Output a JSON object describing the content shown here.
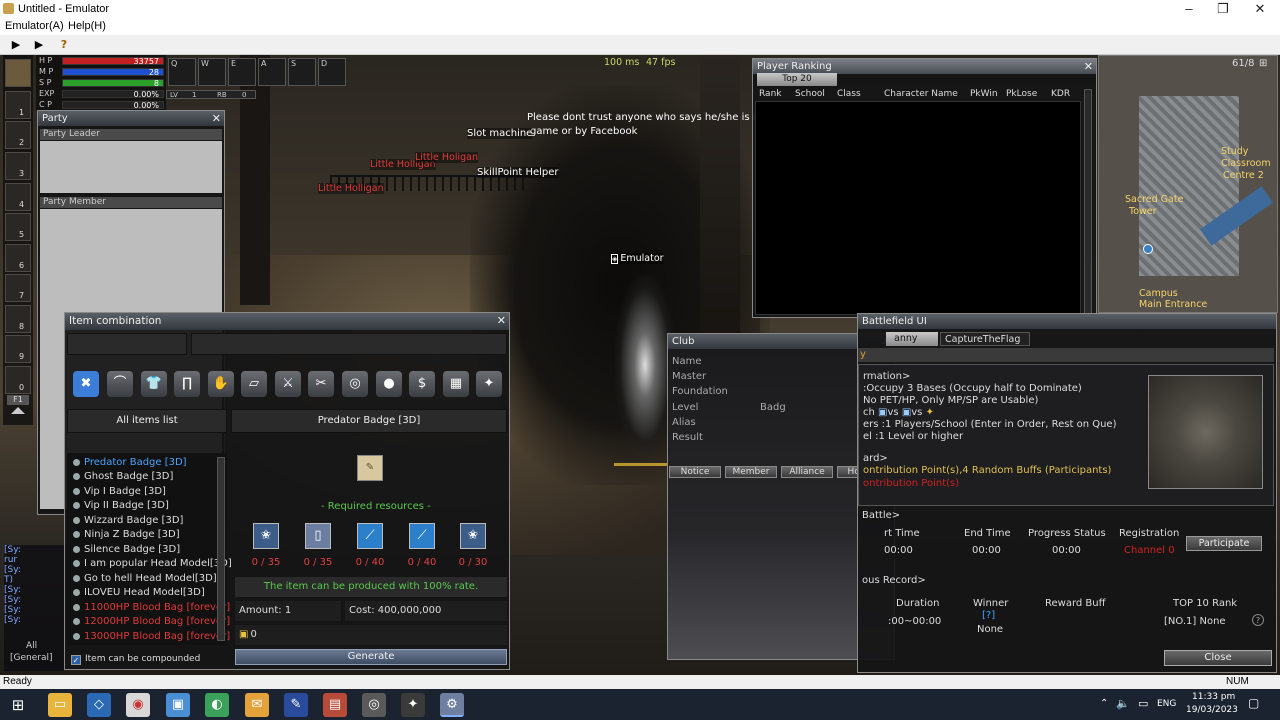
{
  "window": {
    "title": "Untitled - Emulator",
    "min": "‒",
    "max": "❐",
    "close": "✕"
  },
  "menu": {
    "emulator": "Emulator(A)",
    "help": "Help(H)"
  },
  "toolbar": {
    "play1": "▶",
    "play2": "▶",
    "help": "?"
  },
  "hud": {
    "latency": "100 ms",
    "fps": "47 fps",
    "hp_label": "H P",
    "hp_value": "33757",
    "hp_fill": 1.0,
    "mp_label": "M P",
    "mp_value": "28",
    "mp_fill": 1.0,
    "sp_label": "S P",
    "sp_value": "8",
    "sp_fill": 1.0,
    "exp_label": "EXP",
    "exp_value": "0.00%",
    "c_label": "C P",
    "c_value": "0.00%",
    "lv_label": "LV",
    "lv_value": "1",
    "rb_label": "RB",
    "rb_value": "0",
    "quick_keys": [
      "Q",
      "W",
      "E",
      "A",
      "S",
      "D"
    ],
    "hotbar_numbers": [
      "1",
      "2",
      "3",
      "4",
      "5",
      "6",
      "7",
      "8",
      "9",
      "0"
    ],
    "f1": "F1"
  },
  "world": {
    "notice": "Please dont trust anyone who says he/she is GM",
    "notice2": "game or by Facebook",
    "npc_slot": "Slot machine",
    "npc_skill": "SkillPoint Helper",
    "player1": "Little Holligan",
    "player2": "Little Holligan",
    "player3": "Little Holigan",
    "self": "Emulator"
  },
  "chat": {
    "lines": [
      "[Sy:",
      "rur",
      "[Sy:",
      "T)",
      "[Sy:",
      "[Sy:",
      "[Sy:",
      "[Sy:"
    ],
    "all": "All",
    "general": "[General]"
  },
  "party": {
    "title": "Party",
    "leader": "Party Leader",
    "member": "Party Member",
    "close": "✕"
  },
  "itemcomb": {
    "title": "Item combination",
    "close": "✕",
    "all_items": "All items list",
    "selected": "Predator Badge [3D]",
    "required": "- Required resources -",
    "items": [
      {
        "name": "Predator Badge [3D]",
        "color": "#4aa3ff"
      },
      {
        "name": "Ghost  Badge [3D]",
        "color": "#e8e8e8"
      },
      {
        "name": "Vip I Badge [3D]",
        "color": "#e8e8e8"
      },
      {
        "name": "Vip II Badge [3D]",
        "color": "#e8e8e8"
      },
      {
        "name": "Wizzard Badge [3D]",
        "color": "#e8e8e8"
      },
      {
        "name": "Ninja Z Badge [3D]",
        "color": "#e8e8e8"
      },
      {
        "name": "Silence Badge [3D]",
        "color": "#e8e8e8"
      },
      {
        "name": "I am popular Head Model[3D]",
        "color": "#e8e8e8"
      },
      {
        "name": "Go to hell Head Model[3D]",
        "color": "#e8e8e8"
      },
      {
        "name": "ILOVEU Head Model[3D]",
        "color": "#e8e8e8"
      },
      {
        "name": "11000HP Blood Bag [forever]",
        "color": "#e03a3a"
      },
      {
        "name": "12000HP Blood Bag [forever]",
        "color": "#e03a3a"
      },
      {
        "name": "13000HP Blood Bag [forever]",
        "color": "#e03a3a"
      }
    ],
    "resources": [
      "0 / 35",
      "0 / 35",
      "0 / 40",
      "0 / 40",
      "0 / 30"
    ],
    "rate": "The item can be produced with 100% rate.",
    "amount": "Amount: 1",
    "cost": "Cost: 400,000,000",
    "money": "0",
    "compound": "Item can be compounded",
    "generate": "Generate"
  },
  "club": {
    "title": "Club",
    "close": "✕",
    "name": "Name",
    "master": "Master",
    "foundation": "Foundation",
    "level": "Level",
    "level_value": "Badg",
    "alias": "Alias",
    "result": "Result",
    "tabs": [
      "Notice",
      "Member",
      "Alliance",
      "Hostile"
    ]
  },
  "ranking": {
    "title": "Player Ranking",
    "tab": "Top 20",
    "close": "✕",
    "columns": [
      "Rank",
      "School",
      "Class",
      "Character Name",
      "PkWin",
      "PkLose",
      "KDR"
    ]
  },
  "minimap": {
    "counter": "61/8",
    "study": "Study",
    "classroom": "Classroom",
    "centre": "Centre 2",
    "sacred1": "Sacred Gate",
    "sacred2": "Tower",
    "campus": "Campus",
    "main_entrance": "Main Entrance"
  },
  "battle": {
    "title": "Battlefield UI",
    "tab1": "anny",
    "tab2": "CaptureTheFlag",
    "heading": "y",
    "info_head": "rmation>",
    "info1": ":Occupy 3 Bases (Occupy half to Dominate)",
    "info2": "No PET/HP, Only MP/SP are Usable)",
    "info3": "ch",
    "info3b": "vs",
    "info3c": "vs",
    "info4": "ers :1 Players/School (Enter in Order, Rest on Que)",
    "info5": "el :1 Level or higher",
    "reward_head": "ard>",
    "reward1": "ontribution Point(s),4 Random Buffs (Participants)",
    "reward2": "ontribution Point(s)",
    "battle_head": "Battle>",
    "col_start": "rt Time",
    "col_end": "End Time",
    "col_progress": "Progress Status",
    "col_reg": "Registration",
    "start": "00:00",
    "end": "00:00",
    "progress": "00:00",
    "channel": "Channel 0",
    "participate": "Participate",
    "prev_head": "ous Record>",
    "pcol_duration": "Duration",
    "pcol_winner": "Winner",
    "pcol_buff": "Reward Buff",
    "pcol_top": "TOP 10 Rank",
    "duration": ":00~00:00",
    "winner_q": "[?]",
    "winner": "None",
    "top": "[NO.1] None",
    "close": "Close"
  },
  "status": {
    "ready": "Ready",
    "num": "NUM"
  },
  "taskbar": {
    "lang": "ENG",
    "time": "11:33 pm",
    "date": "19/03/2023"
  }
}
